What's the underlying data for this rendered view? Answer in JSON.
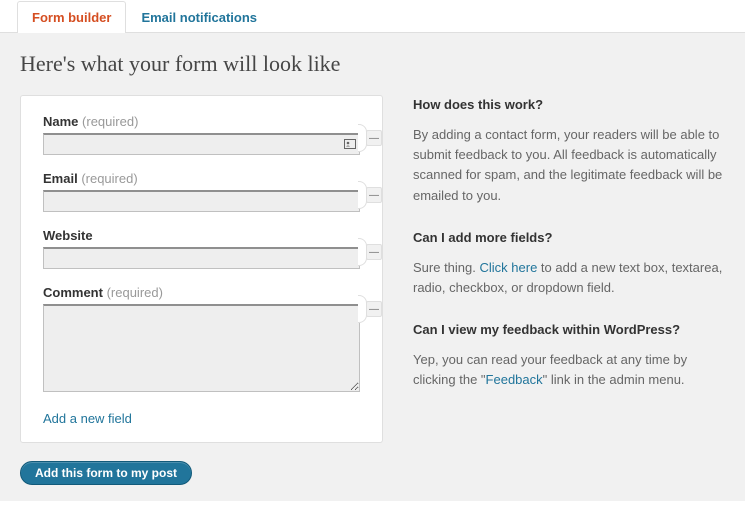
{
  "tabs": {
    "form_builder": "Form builder",
    "email_notifications": "Email notifications"
  },
  "headline": "Here's what your form will look like",
  "fields": [
    {
      "label": "Name",
      "required": "(required)",
      "type": "text"
    },
    {
      "label": "Email",
      "required": "(required)",
      "type": "text"
    },
    {
      "label": "Website",
      "required": "",
      "type": "text"
    },
    {
      "label": "Comment",
      "required": "(required)",
      "type": "textarea"
    }
  ],
  "add_field": "Add a new field",
  "help": {
    "h1": "How does this work?",
    "p1": "By adding a contact form, your readers will be able to submit feedback to you. All feedback is automatically scanned for spam, and the legitimate feedback will be emailed to you.",
    "h2": "Can I add more fields?",
    "p2a": "Sure thing. ",
    "p2_link": "Click here",
    "p2b": " to add a new text box, textarea, radio, checkbox, or dropdown field.",
    "h3": "Can I view my feedback within WordPress?",
    "p3a": "Yep, you can read your feedback at any time by clicking the \"",
    "p3_link": "Feedback",
    "p3b": "\" link in the admin menu."
  },
  "submit": "Add this form to my post",
  "minus": "—"
}
